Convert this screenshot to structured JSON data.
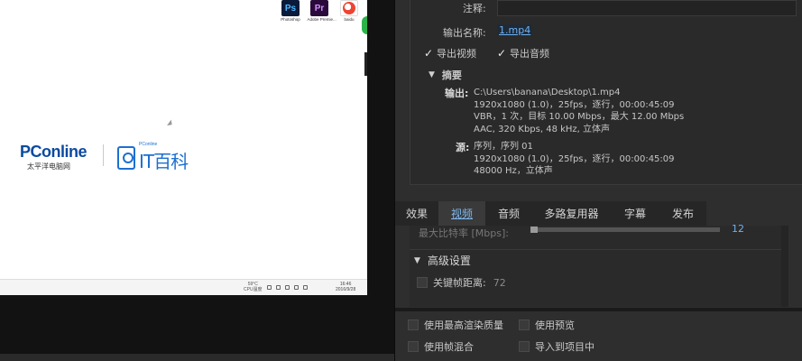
{
  "desktop": {
    "icons": [
      {
        "glyph": "Ps",
        "caption": "Photoshop"
      },
      {
        "glyph": "Pr",
        "caption": "Adobe Premie..."
      },
      {
        "glyph": "",
        "caption": "baidu"
      }
    ],
    "logo_pc_brand": "PConline",
    "logo_pc_sub": "太平洋电脑网",
    "logo_it_small": "PConline",
    "logo_it_big": "IT百科",
    "tray_temp": "59°C",
    "tray_cpu": "CPU温度",
    "clock_time": "16:46",
    "clock_date": "2016/9/28"
  },
  "export": {
    "note_label": "注释:",
    "output_name_label": "输出名称:",
    "output_name_value": "1.mp4",
    "export_video_label": "导出视频",
    "export_audio_label": "导出音频",
    "summary_label": "摘要",
    "output_key": "输出:",
    "output_lines": [
      "C:\\Users\\banana\\Desktop\\1.mp4",
      "1920x1080 (1.0)，25fps，逐行，00:00:45:09",
      "VBR，1 次，目标 10.00 Mbps，最大 12.00 Mbps",
      "AAC, 320 Kbps, 48  kHz, 立体声"
    ],
    "source_key": "源:",
    "source_lines": [
      "序列，序列 01",
      "1920x1080 (1.0)，25fps，逐行，00:00:45:09",
      "48000 Hz，立体声"
    ],
    "tabs": [
      "效果",
      "视频",
      "音频",
      "多路复用器",
      "字幕",
      "发布"
    ],
    "active_tab": "视频",
    "partial_row_label": "最大比特率 [Mbps]:",
    "partial_row_link": "12",
    "advanced_label": "高级设置",
    "keyframe_label": "关键帧距离:",
    "keyframe_value": "72",
    "max_render_label": "使用最高渲染质量",
    "use_preview_label": "使用预览",
    "frame_blend_label": "使用帧混合",
    "import_project_label": "导入到项目中"
  }
}
